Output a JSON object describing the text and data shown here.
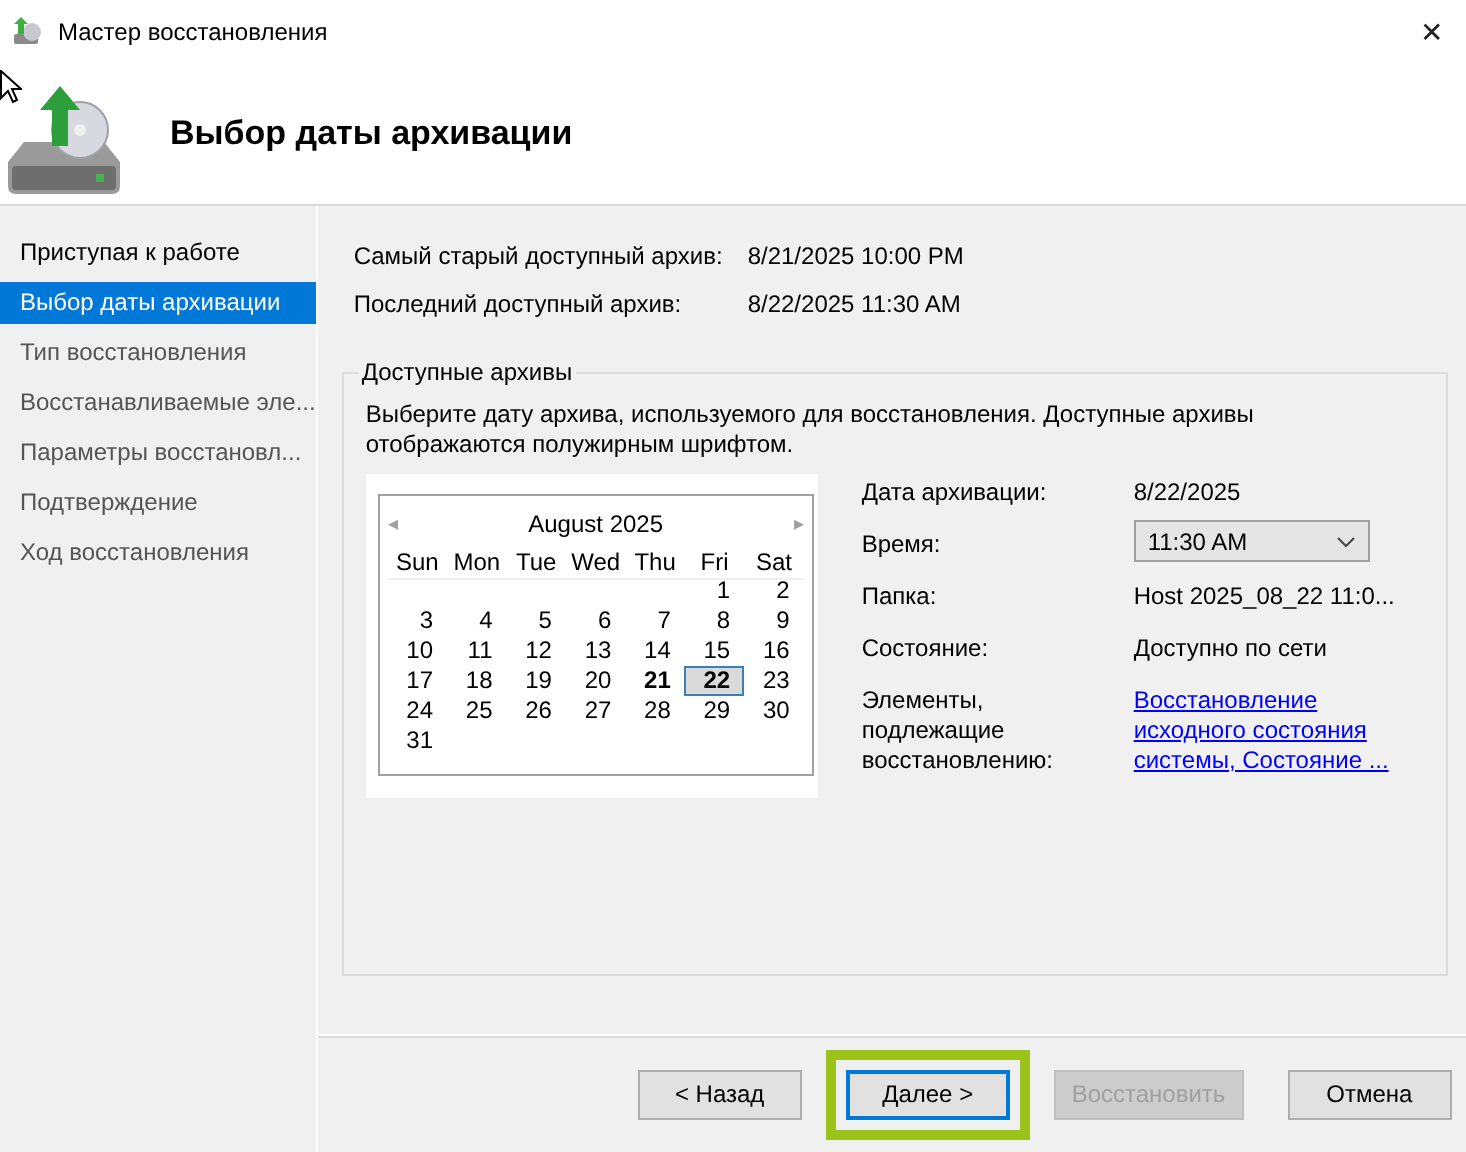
{
  "window": {
    "title": "Мастер восстановления",
    "close": "✕"
  },
  "header": {
    "title": "Выбор даты архивации"
  },
  "sidebar": {
    "items": [
      {
        "label": "Приступая к работе",
        "selected": false,
        "visited": true
      },
      {
        "label": "Выбор даты архивации",
        "selected": true,
        "visited": true
      },
      {
        "label": "Тип восстановления",
        "selected": false,
        "visited": false
      },
      {
        "label": "Восстанавливаемые эле...",
        "selected": false,
        "visited": false
      },
      {
        "label": "Параметры восстановл...",
        "selected": false,
        "visited": false
      },
      {
        "label": "Подтверждение",
        "selected": false,
        "visited": false
      },
      {
        "label": "Ход восстановления",
        "selected": false,
        "visited": false
      }
    ]
  },
  "summary": [
    {
      "label": "Самый старый доступный архив:",
      "value": "8/21/2025 10:00 PM"
    },
    {
      "label": "Последний доступный архив:",
      "value": "8/22/2025 11:30 AM"
    }
  ],
  "group": {
    "title": "Доступные архивы",
    "description": "Выберите дату архива, используемого для восстановления. Доступные архивы отображаются полужирным шрифтом.",
    "calendar": {
      "month": "August 2025",
      "prev": "◂",
      "next": "▸",
      "weekdays": [
        "Sun",
        "Mon",
        "Tue",
        "Wed",
        "Thu",
        "Fri",
        "Sat"
      ],
      "weeks": [
        [
          {
            "kind": "blank"
          },
          {
            "kind": "blank"
          },
          {
            "kind": "blank"
          },
          {
            "kind": "blank"
          },
          {
            "kind": "blank"
          },
          {
            "kind": "day",
            "day": "1",
            "bold": false,
            "selected": false
          },
          {
            "kind": "day",
            "day": "2",
            "bold": false,
            "selected": false
          }
        ],
        [
          {
            "kind": "day",
            "day": "3",
            "bold": false,
            "selected": false
          },
          {
            "kind": "day",
            "day": "4",
            "bold": false,
            "selected": false
          },
          {
            "kind": "day",
            "day": "5",
            "bold": false,
            "selected": false
          },
          {
            "kind": "day",
            "day": "6",
            "bold": false,
            "selected": false
          },
          {
            "kind": "day",
            "day": "7",
            "bold": false,
            "selected": false
          },
          {
            "kind": "day",
            "day": "8",
            "bold": false,
            "selected": false
          },
          {
            "kind": "day",
            "day": "9",
            "bold": false,
            "selected": false
          }
        ],
        [
          {
            "kind": "day",
            "day": "10",
            "bold": false,
            "selected": false
          },
          {
            "kind": "day",
            "day": "11",
            "bold": false,
            "selected": false
          },
          {
            "kind": "day",
            "day": "12",
            "bold": false,
            "selected": false
          },
          {
            "kind": "day",
            "day": "13",
            "bold": false,
            "selected": false
          },
          {
            "kind": "day",
            "day": "14",
            "bold": false,
            "selected": false
          },
          {
            "kind": "day",
            "day": "15",
            "bold": false,
            "selected": false
          },
          {
            "kind": "day",
            "day": "16",
            "bold": false,
            "selected": false
          }
        ],
        [
          {
            "kind": "day",
            "day": "17",
            "bold": false,
            "selected": false
          },
          {
            "kind": "day",
            "day": "18",
            "bold": false,
            "selected": false
          },
          {
            "kind": "day",
            "day": "19",
            "bold": false,
            "selected": false
          },
          {
            "kind": "day",
            "day": "20",
            "bold": false,
            "selected": false
          },
          {
            "kind": "day",
            "day": "21",
            "bold": true,
            "selected": false
          },
          {
            "kind": "day",
            "day": "22",
            "bold": true,
            "selected": true
          },
          {
            "kind": "day",
            "day": "23",
            "bold": false,
            "selected": false
          }
        ],
        [
          {
            "kind": "day",
            "day": "24",
            "bold": false,
            "selected": false
          },
          {
            "kind": "day",
            "day": "25",
            "bold": false,
            "selected": false
          },
          {
            "kind": "day",
            "day": "26",
            "bold": false,
            "selected": false
          },
          {
            "kind": "day",
            "day": "27",
            "bold": false,
            "selected": false
          },
          {
            "kind": "day",
            "day": "28",
            "bold": false,
            "selected": false
          },
          {
            "kind": "day",
            "day": "29",
            "bold": false,
            "selected": false
          },
          {
            "kind": "day",
            "day": "30",
            "bold": false,
            "selected": false
          }
        ],
        [
          {
            "kind": "day",
            "day": "31",
            "bold": false,
            "selected": false
          },
          {
            "kind": "blank"
          },
          {
            "kind": "blank"
          },
          {
            "kind": "blank"
          },
          {
            "kind": "blank"
          },
          {
            "kind": "blank"
          },
          {
            "kind": "blank"
          }
        ]
      ]
    },
    "details": [
      {
        "kind": "text",
        "label": "Дата архивации:",
        "value": "8/22/2025"
      },
      {
        "kind": "dropdown",
        "label": "Время:",
        "value": "11:30 AM"
      },
      {
        "kind": "text",
        "label": "Папка:",
        "value": "Host 2025_08_22 11:0..."
      },
      {
        "kind": "text",
        "label": "Состояние:",
        "value": "Доступно по сети"
      },
      {
        "kind": "link",
        "label": "Элементы, подлежащие восстановлению:",
        "value": "Восстановление исходного состояния системы, Состояние ..."
      }
    ]
  },
  "buttons": [
    {
      "label": "< Назад",
      "disabled": false,
      "focused": false,
      "highlighted": false
    },
    {
      "label": "Далее >",
      "disabled": false,
      "focused": true,
      "highlighted": true
    },
    {
      "label": "Восстановить",
      "disabled": true,
      "focused": false,
      "highlighted": false
    },
    {
      "label": "Отмена",
      "disabled": false,
      "focused": false,
      "highlighted": false
    }
  ]
}
